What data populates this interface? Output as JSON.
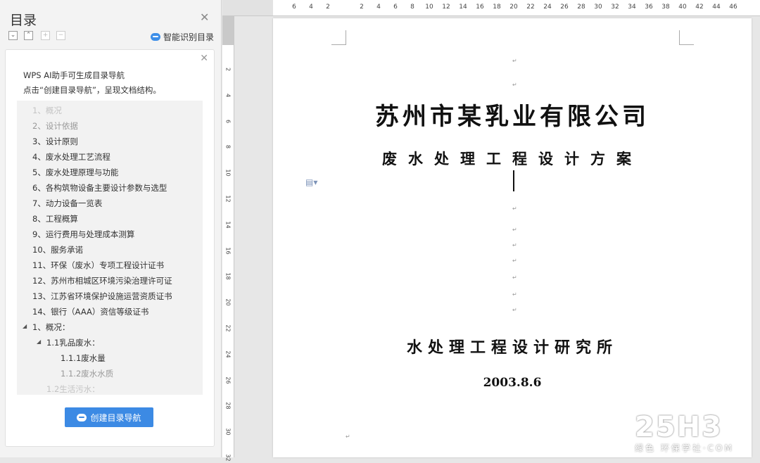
{
  "nav": {
    "title": "目录",
    "close_icon": "close-icon",
    "smart_label": "智能识别目录",
    "card": {
      "tip_line1": "WPS AI助手可生成目录导航",
      "tip_line2": "点击“创建目录导航”，呈现文档结构。",
      "create_button": "创建目录导航"
    },
    "toc": [
      "1、概况",
      "2、设计依据",
      "3、设计原则",
      "4、废水处理工艺流程",
      "5、废水处理原理与功能",
      "6、各构筑物设备主要设计参数与选型",
      "7、动力设备一览表",
      "8、工程概算",
      "9、运行费用与处理成本测算",
      "10、服务承诺",
      "11、环保（废水）专项工程设计证书",
      "12、苏州市相城区环境污染治理许可证",
      "13、江苏省环境保护设施运营资质证书",
      "14、银行（AAA）资信等级证书",
      "1、概况：",
      "1.1乳品废水：",
      "1.1.1废水量",
      "1.1.2废水水质",
      "1.2生活污水："
    ]
  },
  "ruler": {
    "h": [
      "6",
      "4",
      "2",
      "2",
      "4",
      "6",
      "8",
      "10",
      "12",
      "14",
      "16",
      "18",
      "20",
      "22",
      "24",
      "26",
      "28",
      "30",
      "32",
      "34",
      "36",
      "38",
      "40",
      "42",
      "44",
      "46"
    ],
    "v": [
      "2",
      "4",
      "6",
      "8",
      "10",
      "12",
      "14",
      "16",
      "18",
      "20",
      "22",
      "24",
      "26",
      "28",
      "30",
      "32"
    ]
  },
  "document": {
    "company": "苏州市某乳业有限公司",
    "subtitle": "废水处理工程设计方案",
    "institute": "水处理工程设计研究所",
    "date": "2003.8.6"
  },
  "paragraph_mark": "↵",
  "watermark": {
    "big": "25H3",
    "small": "绿色 环保学社·COM"
  }
}
